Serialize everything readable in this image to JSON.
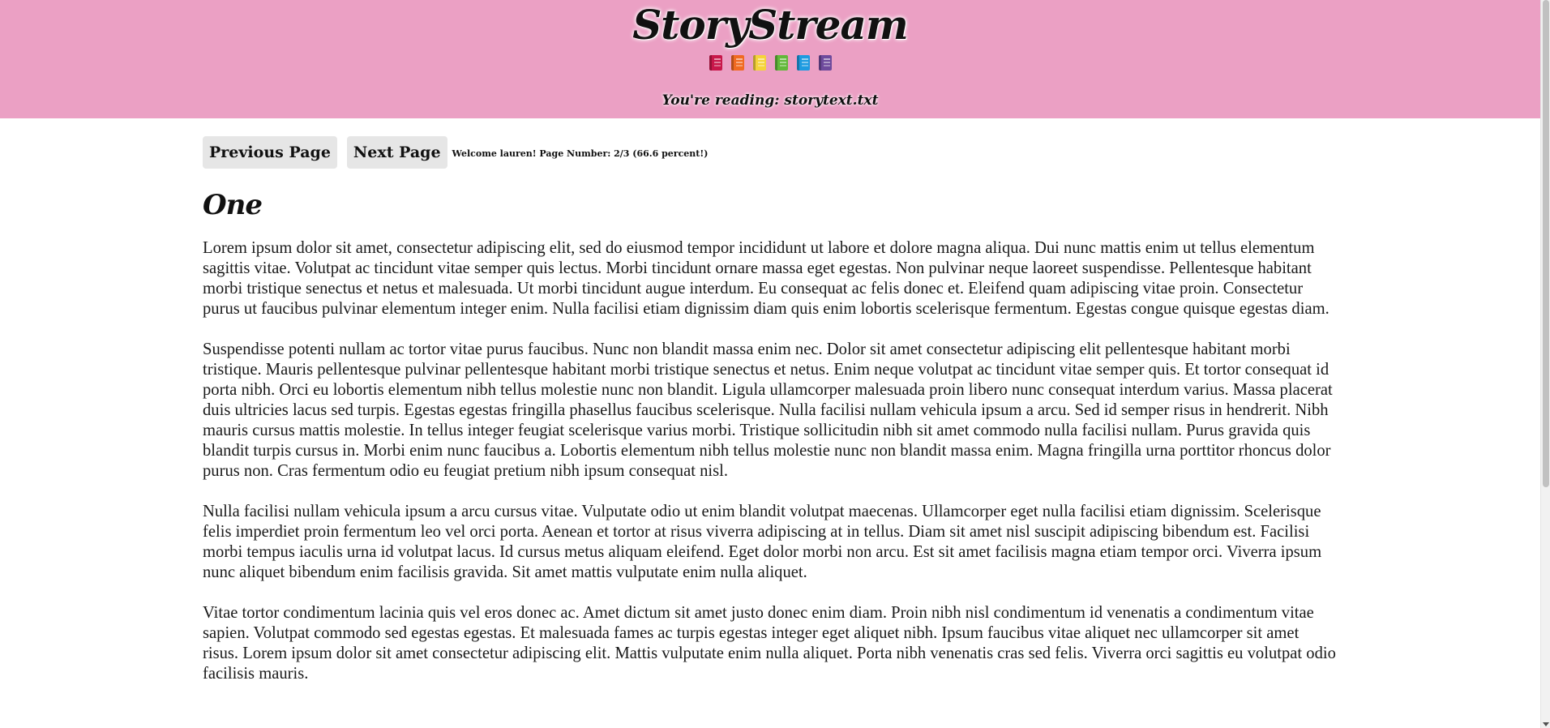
{
  "header": {
    "title": "StoryStream",
    "books": [
      {
        "name": "red-book-icon",
        "color": "#c8174a"
      },
      {
        "name": "orange-book-icon",
        "color": "#f06a22"
      },
      {
        "name": "yellow-book-icon",
        "color": "#f5d33b"
      },
      {
        "name": "green-book-icon",
        "color": "#62b83a"
      },
      {
        "name": "blue-book-icon",
        "color": "#1e9be0"
      },
      {
        "name": "purple-book-icon",
        "color": "#6e4a9c"
      }
    ],
    "reading": "You're reading: storytext.txt",
    "background": "#eba0c4"
  },
  "nav": {
    "previous_label": "Previous Page",
    "next_label": "Next Page",
    "status": "Welcome lauren! Page Number: 2/3 (66.6 percent!)"
  },
  "chapter": {
    "title": "One",
    "paragraphs": [
      "Lorem ipsum dolor sit amet, consectetur adipiscing elit, sed do eiusmod tempor incididunt ut labore et dolore magna aliqua. Dui nunc mattis enim ut tellus elementum sagittis vitae. Volutpat ac tincidunt vitae semper quis lectus. Morbi tincidunt ornare massa eget egestas. Non pulvinar neque laoreet suspendisse. Pellentesque habitant morbi tristique senectus et netus et malesuada. Ut morbi tincidunt augue interdum. Eu consequat ac felis donec et. Eleifend quam adipiscing vitae proin. Consectetur purus ut faucibus pulvinar elementum integer enim. Nulla facilisi etiam dignissim diam quis enim lobortis scelerisque fermentum. Egestas congue quisque egestas diam.",
      "Suspendisse potenti nullam ac tortor vitae purus faucibus. Nunc non blandit massa enim nec. Dolor sit amet consectetur adipiscing elit pellentesque habitant morbi tristique. Mauris pellentesque pulvinar pellentesque habitant morbi tristique senectus et netus. Enim neque volutpat ac tincidunt vitae semper quis. Et tortor consequat id porta nibh. Orci eu lobortis elementum nibh tellus molestie nunc non blandit. Ligula ullamcorper malesuada proin libero nunc consequat interdum varius. Massa placerat duis ultricies lacus sed turpis. Egestas egestas fringilla phasellus faucibus scelerisque. Nulla facilisi nullam vehicula ipsum a arcu. Sed id semper risus in hendrerit. Nibh mauris cursus mattis molestie. In tellus integer feugiat scelerisque varius morbi. Tristique sollicitudin nibh sit amet commodo nulla facilisi nullam. Purus gravida quis blandit turpis cursus in. Morbi enim nunc faucibus a. Lobortis elementum nibh tellus molestie nunc non blandit massa enim. Magna fringilla urna porttitor rhoncus dolor purus non. Cras fermentum odio eu feugiat pretium nibh ipsum consequat nisl.",
      "Nulla facilisi nullam vehicula ipsum a arcu cursus vitae. Vulputate odio ut enim blandit volutpat maecenas. Ullamcorper eget nulla facilisi etiam dignissim. Scelerisque felis imperdiet proin fermentum leo vel orci porta. Aenean et tortor at risus viverra adipiscing at in tellus. Diam sit amet nisl suscipit adipiscing bibendum est. Facilisi morbi tempus iaculis urna id volutpat lacus. Id cursus metus aliquam eleifend. Eget dolor morbi non arcu. Est sit amet facilisis magna etiam tempor orci. Viverra ipsum nunc aliquet bibendum enim facilisis gravida. Sit amet mattis vulputate enim nulla aliquet.",
      "Vitae tortor condimentum lacinia quis vel eros donec ac. Amet dictum sit amet justo donec enim diam. Proin nibh nisl condimentum id venenatis a condimentum vitae sapien. Volutpat commodo sed egestas egestas. Et malesuada fames ac turpis egestas integer eget aliquet nibh. Ipsum faucibus vitae aliquet nec ullamcorper sit amet risus. Lorem ipsum dolor sit amet consectetur adipiscing elit. Mattis vulputate enim nulla aliquet. Porta nibh venenatis cras sed felis. Viverra orci sagittis eu volutpat odio facilisis mauris."
    ]
  }
}
